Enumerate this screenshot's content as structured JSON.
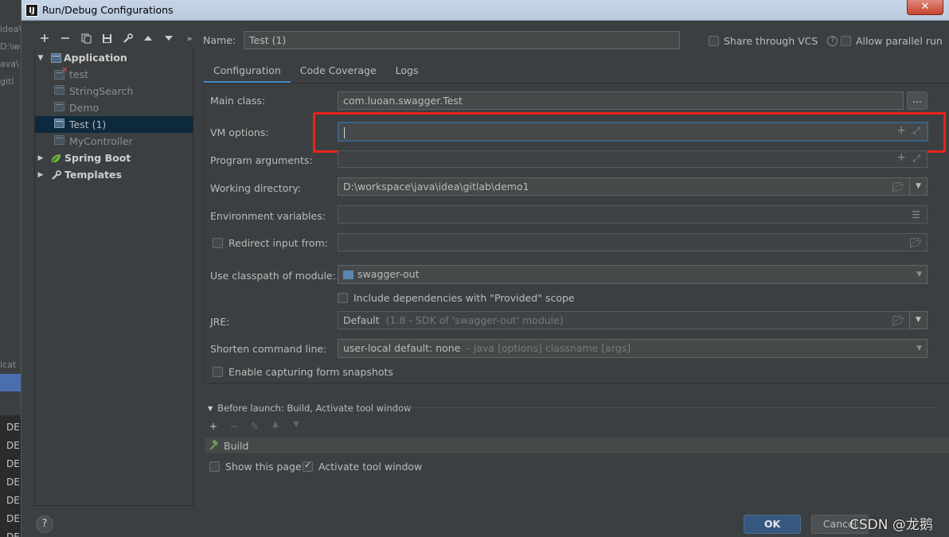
{
  "background": {
    "fragments_top": [
      "idea\\",
      "D:\\wo",
      "ava\\",
      "gitl"
    ],
    "fragment_mid": "icat",
    "lower_rows": [
      "DE",
      "DE",
      "DE",
      "DE",
      "DE",
      "DE",
      "DE"
    ]
  },
  "window": {
    "title": "Run/Debug Configurations",
    "app_icon": "IJ",
    "close_label": "✕"
  },
  "toolbar": {
    "icons": [
      "add-icon",
      "remove-icon",
      "copy-icon",
      "save-icon",
      "wrench-icon",
      "move-up-icon",
      "move-down-icon",
      "more-icon"
    ]
  },
  "tree": {
    "application_label": "Application",
    "items": [
      {
        "label": "test"
      },
      {
        "label": "StringSearch"
      },
      {
        "label": "Demo"
      },
      {
        "label": "Test (1)"
      },
      {
        "label": "MyController"
      }
    ],
    "spring_boot_label": "Spring Boot",
    "templates_label": "Templates"
  },
  "name_field": {
    "label": "Name:",
    "value": "Test (1)"
  },
  "options": {
    "share_vcs": "Share through VCS",
    "parallel_run": "Allow parallel run"
  },
  "tabs": [
    {
      "label": "Configuration",
      "active": true
    },
    {
      "label": "Code Coverage",
      "active": false
    },
    {
      "label": "Logs",
      "active": false
    }
  ],
  "form": {
    "main_class_label": "Main class:",
    "main_class_value": "com.luoan.swagger.Test",
    "vm_options_label": "VM options:",
    "vm_options_value": "",
    "program_args_label": "Program arguments:",
    "working_dir_label": "Working directory:",
    "working_dir_value": "D:\\workspace\\java\\idea\\gitlab\\demo1",
    "env_vars_label": "Environment variables:",
    "redirect_label": "Redirect input from:",
    "classpath_label": "Use classpath of module:",
    "classpath_value": "swagger-out",
    "include_deps_label": "Include dependencies with \"Provided\" scope",
    "jre_label": "JRE:",
    "jre_value": "Default",
    "jre_hint": "(1.8 - SDK of 'swagger-out' module)",
    "shorten_label": "Shorten command line:",
    "shorten_value": "user-local default: none",
    "shorten_hint": "- java [options] classname [args]",
    "snapshots_label": "Enable capturing form snapshots",
    "dots_label": "..."
  },
  "before_launch": {
    "title": "Before launch: Build, Activate tool window",
    "build_label": "Build",
    "show_page_label": "Show this page",
    "activate_label": "Activate tool window"
  },
  "buttons": {
    "help": "?",
    "ok": "OK",
    "cancel": "Cancel"
  },
  "watermark": "CSDN @龙鹅",
  "colors": {
    "accent": "#4a88c7",
    "highlight": "#e8231b",
    "selection": "#0d293e",
    "ok": "#365880"
  }
}
